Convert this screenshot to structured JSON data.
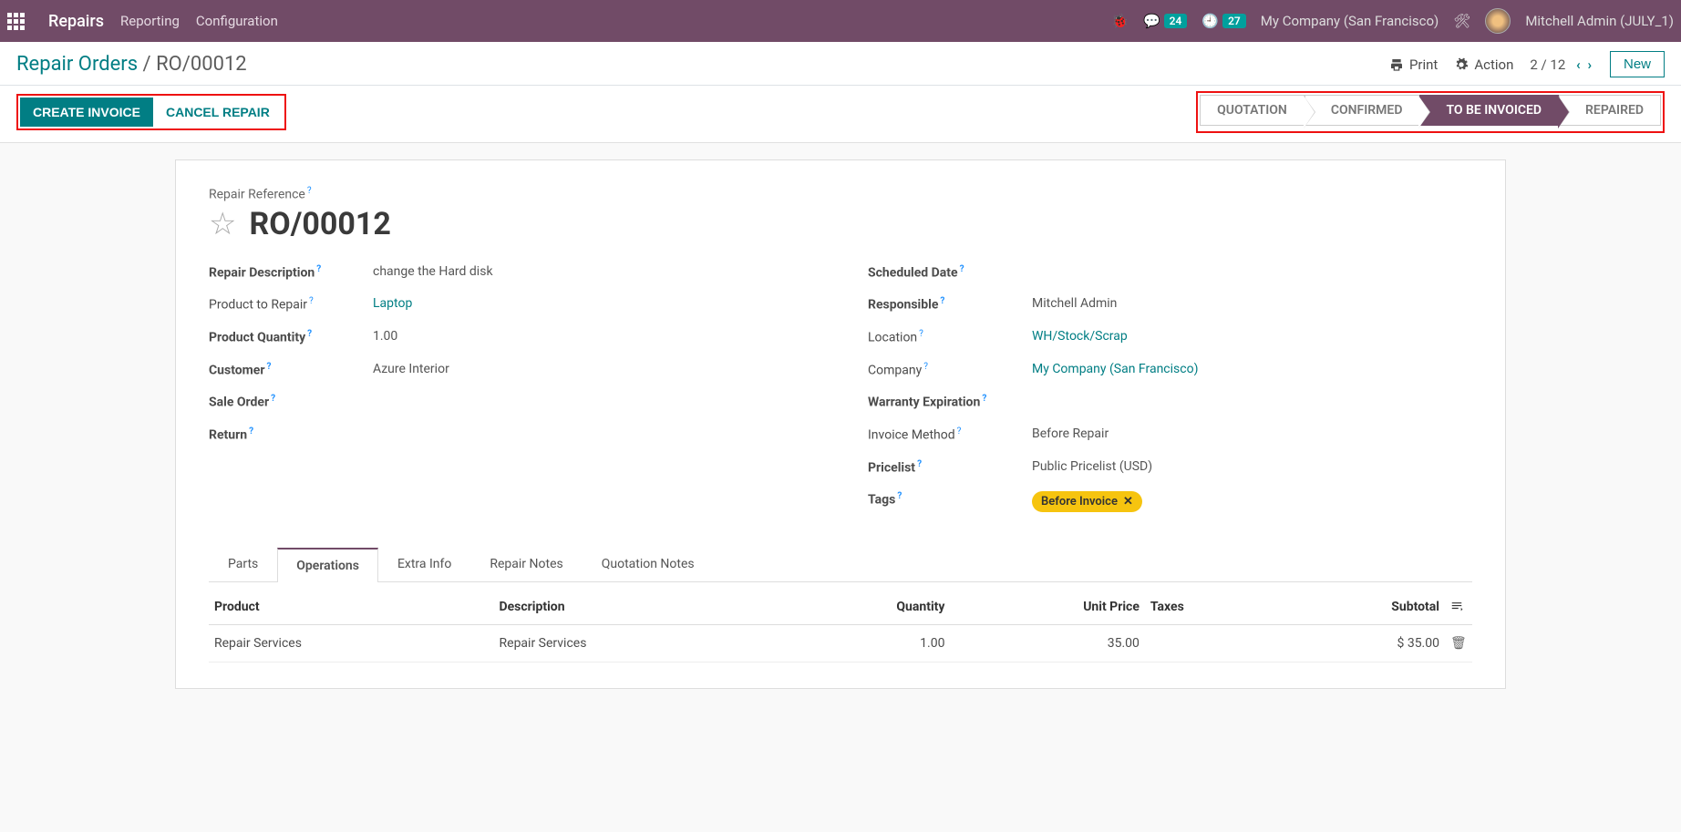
{
  "topbar": {
    "brand": "Repairs",
    "nav": [
      "Reporting",
      "Configuration"
    ],
    "msg_badge": "24",
    "activity_badge": "27",
    "company": "My Company (San Francisco)",
    "user": "Mitchell Admin (JULY_1)"
  },
  "breadcrumb": {
    "root": "Repair Orders",
    "current": "RO/00012"
  },
  "controls": {
    "print": "Print",
    "action": "Action",
    "pager": "2 / 12",
    "new": "New"
  },
  "actions": {
    "create_invoice": "CREATE INVOICE",
    "cancel": "CANCEL REPAIR"
  },
  "status_steps": [
    "QUOTATION",
    "CONFIRMED",
    "TO BE INVOICED",
    "REPAIRED"
  ],
  "status_active": 2,
  "ref": {
    "label": "Repair Reference",
    "value": "RO/00012"
  },
  "left_fields": [
    {
      "label": "Repair Description",
      "bold": true,
      "value": "change the Hard disk"
    },
    {
      "label": "Product to Repair",
      "bold": false,
      "value": "Laptop",
      "link": true
    },
    {
      "label": "Product Quantity",
      "bold": true,
      "value": "1.00"
    },
    {
      "label": "Customer",
      "bold": true,
      "value": "Azure Interior"
    },
    {
      "label": "Sale Order",
      "bold": true,
      "value": ""
    },
    {
      "label": "Return",
      "bold": true,
      "value": ""
    }
  ],
  "right_fields": [
    {
      "label": "Scheduled Date",
      "bold": true,
      "value": ""
    },
    {
      "label": "Responsible",
      "bold": true,
      "value": "Mitchell Admin"
    },
    {
      "label": "Location",
      "bold": false,
      "value": "WH/Stock/Scrap",
      "link": true
    },
    {
      "label": "Company",
      "bold": false,
      "value": "My Company (San Francisco)",
      "link": true
    },
    {
      "label": "Warranty Expiration",
      "bold": true,
      "value": ""
    },
    {
      "label": "Invoice Method",
      "bold": false,
      "value": "Before Repair"
    },
    {
      "label": "Pricelist",
      "bold": true,
      "value": "Public Pricelist (USD)"
    },
    {
      "label": "Tags",
      "bold": true,
      "tag": "Before Invoice"
    }
  ],
  "tabs": [
    "Parts",
    "Operations",
    "Extra Info",
    "Repair Notes",
    "Quotation Notes"
  ],
  "tab_active": 1,
  "table": {
    "headers": [
      "Product",
      "Description",
      "Quantity",
      "Unit Price",
      "Taxes",
      "Subtotal"
    ],
    "rows": [
      {
        "product": "Repair Services",
        "description": "Repair Services",
        "quantity": "1.00",
        "unit_price": "35.00",
        "taxes": "",
        "subtotal": "$ 35.00"
      }
    ]
  }
}
